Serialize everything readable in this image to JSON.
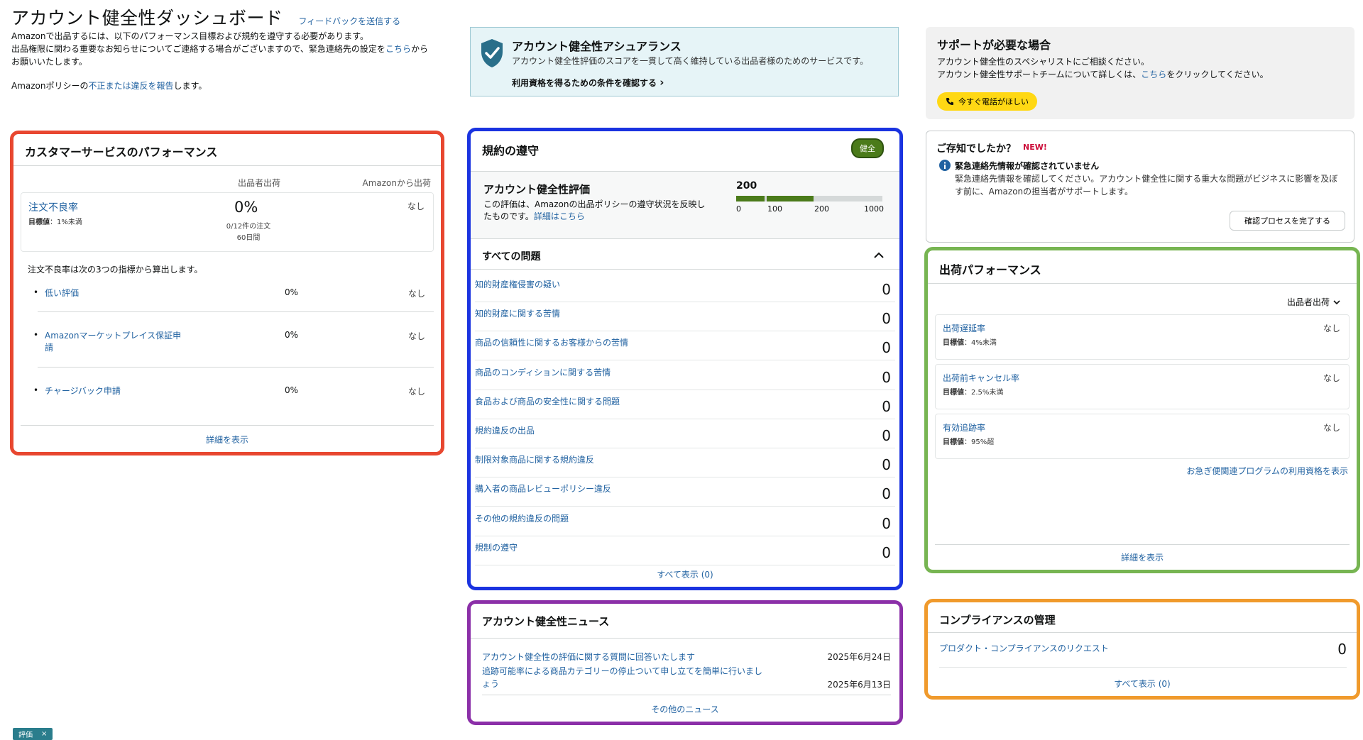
{
  "header": {
    "title": "アカウント健全性ダッシュボード",
    "feedback": "フィードバックを送信する",
    "line1": "Amazonで出品するには、以下のパフォーマンス目標および規約を遵守する必要があります。",
    "line2_pre": "出品権限に関わる重要なお知らせについてご連絡する場合がございますので、緊急連絡先の設定を",
    "line2_link": "こちら",
    "line2_post": "から",
    "line3": "お願いいたします。",
    "policy_pre": "Amazonポリシーの",
    "policy_link": "不正または違反を報告",
    "policy_post": "します。"
  },
  "assurance": {
    "title": "アカウント健全性アシュアランス",
    "desc": "アカウント健全性評価のスコアを一貫して高く維持している出品者様のためのサービスです。",
    "link": "利用資格を得るための条件を確認する",
    "chevron": "›",
    "icon": "shield-check-icon"
  },
  "support": {
    "title": "サポートが必要な場合",
    "line1": "アカウント健全性のスペシャリストにご相談ください。",
    "line2_pre": "アカウント健全性サポートチームについて詳しくは、",
    "line2_link": "こちら",
    "line2_post": "をクリックしてください。",
    "call_button": "今すぐ電話がほしい",
    "accent": "#ffd814"
  },
  "customer_service": {
    "title": "カスタマーサービスのパフォーマンス",
    "col_seller": "出品者出荷",
    "col_amazon": "Amazonから出荷",
    "odr": {
      "label": "注文不良率",
      "target_label": "目標値",
      "target": "：1%未満",
      "value": "0%",
      "sub1": "0/12件の注文",
      "sub2": "60日間",
      "amazon": "なし"
    },
    "calc_text": "注文不良率は次の3つの指標から算出します。",
    "metrics": [
      {
        "label": "低い評価",
        "value": "0%",
        "amazon": "なし"
      },
      {
        "label": "Amazonマーケットプレイス保証申請",
        "value": "0%",
        "amazon": "なし"
      },
      {
        "label": "チャージバック申請",
        "value": "0%",
        "amazon": "なし"
      }
    ],
    "view_detail": "詳細を表示",
    "border_color": "#e84730"
  },
  "compliance": {
    "title": "規約の遵守",
    "badge": "健全",
    "ahr_title": "アカウント健全性評価",
    "ahr_desc": "この評価は、Amazonの出品ポリシーの遵守状況を反映したものです。",
    "ahr_link": "詳細はこちら",
    "score": "200",
    "score_value": 200,
    "ticks": [
      "0",
      "100",
      "200",
      "1000"
    ],
    "all_issues": "すべての問題",
    "issues": [
      {
        "label": "知的財産権侵害の疑い",
        "value": "0"
      },
      {
        "label": "知的財産に関する苦情",
        "value": "0"
      },
      {
        "label": "商品の信頼性に関するお客様からの苦情",
        "value": "0"
      },
      {
        "label": "商品のコンディションに関する苦情",
        "value": "0"
      },
      {
        "label": "食品および商品の安全性に関する問題",
        "value": "0"
      },
      {
        "label": "規約違反の出品",
        "value": "0"
      },
      {
        "label": "制限対象商品に関する規約違反",
        "value": "0"
      },
      {
        "label": "購入者の商品レビューポリシー違反",
        "value": "0"
      },
      {
        "label": "その他の規約違反の問題",
        "value": "0"
      },
      {
        "label": "規制の遵守",
        "value": "0"
      }
    ],
    "show_all": "すべて表示 (0)",
    "border_color": "#1a33e0",
    "bar_color": "#4b7b1a"
  },
  "news": {
    "title": "アカウント健全性ニュース",
    "items": [
      {
        "label": "アカウント健全性の評価に関する質問に回答いたします",
        "date": "2025年6月24日"
      },
      {
        "label": "追跡可能率による商品カテゴリーの停止ついて申し立てを簡単に行いましょう",
        "date": "2025年6月13日"
      }
    ],
    "more": "その他のニュース",
    "border_color": "#8b2fa8"
  },
  "did_you_know": {
    "title": "ご存知でしたか？",
    "new": "NEW!",
    "heading": "緊急連絡先情報が確認されていません",
    "body": "緊急連絡先情報を確認してください。アカウント健全性に関する重大な問題がビジネスに影響を及ぼす前に、Amazonの担当者がサポートします。",
    "button": "確認プロセスを完了する"
  },
  "shipping": {
    "title": "出荷パフォーマンス",
    "dropdown": "出品者出荷",
    "target_label": "目標値",
    "metrics": [
      {
        "label": "出荷遅延率",
        "target": "：4%未満",
        "value": "なし"
      },
      {
        "label": "出荷前キャンセル率",
        "target": "：2.5%未満",
        "value": "なし"
      },
      {
        "label": "有効追跡率",
        "target": "：95%超",
        "value": "なし"
      }
    ],
    "fast_link": "お急ぎ便関連プログラムの利用資格を表示",
    "view_detail": "詳細を表示",
    "border_color": "#77b552"
  },
  "compliance_mgmt": {
    "title": "コンプライアンスの管理",
    "row_label": "プロダクト・コンプライアンスのリクエスト",
    "row_value": "0",
    "show_all": "すべて表示 (0)",
    "border_color": "#f09a2c"
  },
  "tag": {
    "label": "評価",
    "close": "×"
  }
}
